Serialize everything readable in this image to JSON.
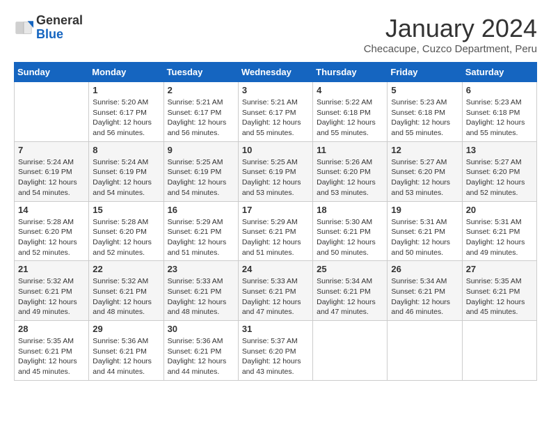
{
  "header": {
    "logo_general": "General",
    "logo_blue": "Blue",
    "month_title": "January 2024",
    "subtitle": "Checacupe, Cuzco Department, Peru"
  },
  "calendar": {
    "days_of_week": [
      "Sunday",
      "Monday",
      "Tuesday",
      "Wednesday",
      "Thursday",
      "Friday",
      "Saturday"
    ],
    "weeks": [
      [
        {
          "day": "",
          "info": ""
        },
        {
          "day": "1",
          "info": "Sunrise: 5:20 AM\nSunset: 6:17 PM\nDaylight: 12 hours\nand 56 minutes."
        },
        {
          "day": "2",
          "info": "Sunrise: 5:21 AM\nSunset: 6:17 PM\nDaylight: 12 hours\nand 56 minutes."
        },
        {
          "day": "3",
          "info": "Sunrise: 5:21 AM\nSunset: 6:17 PM\nDaylight: 12 hours\nand 55 minutes."
        },
        {
          "day": "4",
          "info": "Sunrise: 5:22 AM\nSunset: 6:18 PM\nDaylight: 12 hours\nand 55 minutes."
        },
        {
          "day": "5",
          "info": "Sunrise: 5:23 AM\nSunset: 6:18 PM\nDaylight: 12 hours\nand 55 minutes."
        },
        {
          "day": "6",
          "info": "Sunrise: 5:23 AM\nSunset: 6:18 PM\nDaylight: 12 hours\nand 55 minutes."
        }
      ],
      [
        {
          "day": "7",
          "info": "Sunrise: 5:24 AM\nSunset: 6:19 PM\nDaylight: 12 hours\nand 54 minutes."
        },
        {
          "day": "8",
          "info": "Sunrise: 5:24 AM\nSunset: 6:19 PM\nDaylight: 12 hours\nand 54 minutes."
        },
        {
          "day": "9",
          "info": "Sunrise: 5:25 AM\nSunset: 6:19 PM\nDaylight: 12 hours\nand 54 minutes."
        },
        {
          "day": "10",
          "info": "Sunrise: 5:25 AM\nSunset: 6:19 PM\nDaylight: 12 hours\nand 53 minutes."
        },
        {
          "day": "11",
          "info": "Sunrise: 5:26 AM\nSunset: 6:20 PM\nDaylight: 12 hours\nand 53 minutes."
        },
        {
          "day": "12",
          "info": "Sunrise: 5:27 AM\nSunset: 6:20 PM\nDaylight: 12 hours\nand 53 minutes."
        },
        {
          "day": "13",
          "info": "Sunrise: 5:27 AM\nSunset: 6:20 PM\nDaylight: 12 hours\nand 52 minutes."
        }
      ],
      [
        {
          "day": "14",
          "info": "Sunrise: 5:28 AM\nSunset: 6:20 PM\nDaylight: 12 hours\nand 52 minutes."
        },
        {
          "day": "15",
          "info": "Sunrise: 5:28 AM\nSunset: 6:20 PM\nDaylight: 12 hours\nand 52 minutes."
        },
        {
          "day": "16",
          "info": "Sunrise: 5:29 AM\nSunset: 6:21 PM\nDaylight: 12 hours\nand 51 minutes."
        },
        {
          "day": "17",
          "info": "Sunrise: 5:29 AM\nSunset: 6:21 PM\nDaylight: 12 hours\nand 51 minutes."
        },
        {
          "day": "18",
          "info": "Sunrise: 5:30 AM\nSunset: 6:21 PM\nDaylight: 12 hours\nand 50 minutes."
        },
        {
          "day": "19",
          "info": "Sunrise: 5:31 AM\nSunset: 6:21 PM\nDaylight: 12 hours\nand 50 minutes."
        },
        {
          "day": "20",
          "info": "Sunrise: 5:31 AM\nSunset: 6:21 PM\nDaylight: 12 hours\nand 49 minutes."
        }
      ],
      [
        {
          "day": "21",
          "info": "Sunrise: 5:32 AM\nSunset: 6:21 PM\nDaylight: 12 hours\nand 49 minutes."
        },
        {
          "day": "22",
          "info": "Sunrise: 5:32 AM\nSunset: 6:21 PM\nDaylight: 12 hours\nand 48 minutes."
        },
        {
          "day": "23",
          "info": "Sunrise: 5:33 AM\nSunset: 6:21 PM\nDaylight: 12 hours\nand 48 minutes."
        },
        {
          "day": "24",
          "info": "Sunrise: 5:33 AM\nSunset: 6:21 PM\nDaylight: 12 hours\nand 47 minutes."
        },
        {
          "day": "25",
          "info": "Sunrise: 5:34 AM\nSunset: 6:21 PM\nDaylight: 12 hours\nand 47 minutes."
        },
        {
          "day": "26",
          "info": "Sunrise: 5:34 AM\nSunset: 6:21 PM\nDaylight: 12 hours\nand 46 minutes."
        },
        {
          "day": "27",
          "info": "Sunrise: 5:35 AM\nSunset: 6:21 PM\nDaylight: 12 hours\nand 45 minutes."
        }
      ],
      [
        {
          "day": "28",
          "info": "Sunrise: 5:35 AM\nSunset: 6:21 PM\nDaylight: 12 hours\nand 45 minutes."
        },
        {
          "day": "29",
          "info": "Sunrise: 5:36 AM\nSunset: 6:21 PM\nDaylight: 12 hours\nand 44 minutes."
        },
        {
          "day": "30",
          "info": "Sunrise: 5:36 AM\nSunset: 6:21 PM\nDaylight: 12 hours\nand 44 minutes."
        },
        {
          "day": "31",
          "info": "Sunrise: 5:37 AM\nSunset: 6:20 PM\nDaylight: 12 hours\nand 43 minutes."
        },
        {
          "day": "",
          "info": ""
        },
        {
          "day": "",
          "info": ""
        },
        {
          "day": "",
          "info": ""
        }
      ]
    ]
  }
}
